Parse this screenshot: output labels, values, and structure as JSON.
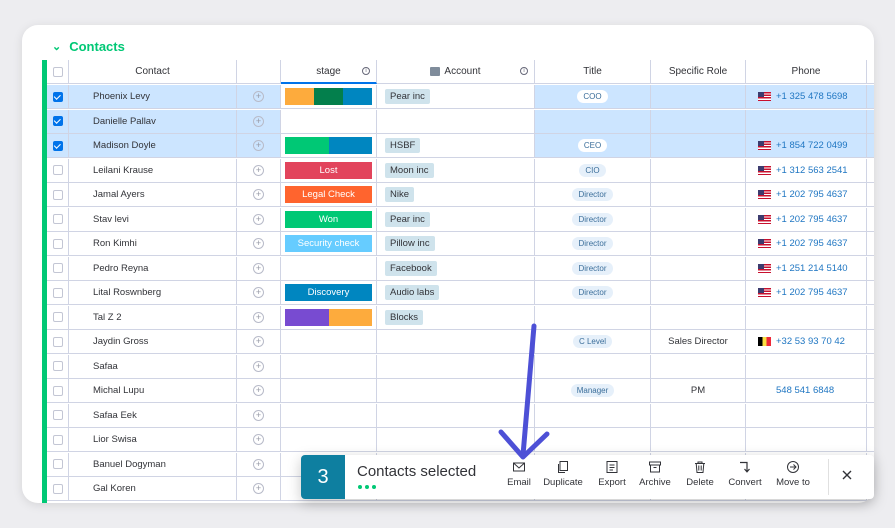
{
  "group": {
    "title": "Contacts"
  },
  "columns": {
    "contact": "Contact",
    "stage": "stage",
    "account": "Account",
    "title": "Title",
    "role": "Specific Role",
    "phone": "Phone"
  },
  "rows": [
    {
      "checked": true,
      "name": "Phoenix Levy",
      "stage": {
        "segments": [
          "#fdab3d",
          "#037f4c",
          "#0086c0"
        ]
      },
      "account": "Pear inc",
      "title": "COO",
      "role": "",
      "phone": {
        "flag": "us",
        "number": "+1 325 478 5698"
      }
    },
    {
      "checked": true,
      "name": "Danielle Pallav",
      "stage": null,
      "account": "",
      "title": "",
      "role": "",
      "phone": null
    },
    {
      "checked": true,
      "name": "Madison Doyle",
      "stage": {
        "segments": [
          "#00c875",
          "#0086c0"
        ]
      },
      "account": "HSBF",
      "title": "CEO",
      "role": "",
      "phone": {
        "flag": "us",
        "number": "+1 854 722 0499"
      }
    },
    {
      "checked": false,
      "name": "Leilani Krause",
      "stage": {
        "label": "Lost",
        "color": "#e2445c"
      },
      "account": "Moon inc",
      "title": "CIO",
      "role": "",
      "phone": {
        "flag": "us",
        "number": "+1 312 563 2541"
      }
    },
    {
      "checked": false,
      "name": "Jamal Ayers",
      "stage": {
        "label": "Legal Check",
        "color": "#ff642e"
      },
      "account": "Nike",
      "title": "Director",
      "role": "",
      "phone": {
        "flag": "us",
        "number": "+1 202 795 4637"
      }
    },
    {
      "checked": false,
      "name": "Stav levi",
      "stage": {
        "label": "Won",
        "color": "#00c875"
      },
      "account": "Pear inc",
      "title": "Director",
      "role": "",
      "phone": {
        "flag": "us",
        "number": "+1 202 795 4637"
      }
    },
    {
      "checked": false,
      "name": "Ron Kimhi",
      "stage": {
        "label": "Security check",
        "color": "#66ccff"
      },
      "account": "Pillow inc",
      "title": "Director",
      "role": "",
      "phone": {
        "flag": "us",
        "number": "+1 202 795 4637"
      }
    },
    {
      "checked": false,
      "name": "Pedro Reyna",
      "stage": null,
      "account": "Facebook",
      "title": "Director",
      "role": "",
      "phone": {
        "flag": "us",
        "number": "+1 251 214 5140"
      }
    },
    {
      "checked": false,
      "name": "Lital Roswnberg",
      "stage": {
        "label": "Discovery",
        "color": "#0086c0"
      },
      "account": "Audio labs",
      "title": "Director",
      "role": "",
      "phone": {
        "flag": "us",
        "number": "+1 202 795 4637"
      }
    },
    {
      "checked": false,
      "name": "Tal Z 2",
      "stage": {
        "segments": [
          "#784bd1",
          "#fdab3d"
        ]
      },
      "account": "Blocks",
      "title": "",
      "role": "",
      "phone": null
    },
    {
      "checked": false,
      "name": "Jaydin Gross",
      "stage": null,
      "account": "",
      "title": "C Level",
      "role": "Sales Director",
      "phone": {
        "flag": "be",
        "number": "+32 53 93 70 42"
      }
    },
    {
      "checked": false,
      "name": "Safaa",
      "stage": null,
      "account": "",
      "title": "",
      "role": "",
      "phone": null
    },
    {
      "checked": false,
      "name": "Michal Lupu",
      "stage": null,
      "account": "",
      "title": "Manager",
      "role": "PM",
      "phone": {
        "flag": "",
        "number": "548 541 6848"
      }
    },
    {
      "checked": false,
      "name": "Safaa Eek",
      "stage": null,
      "account": "",
      "title": "",
      "role": "",
      "phone": null
    },
    {
      "checked": false,
      "name": "Lior Swisa",
      "stage": null,
      "account": "",
      "title": "",
      "role": "",
      "phone": null
    },
    {
      "checked": false,
      "name": "Banuel Dogyman",
      "stage": null,
      "account": "",
      "title": "",
      "role": "",
      "phone": null
    },
    {
      "checked": false,
      "name": "Gal Koren",
      "stage": null,
      "account": "",
      "title": "",
      "role": "",
      "phone": null
    }
  ],
  "action_bar": {
    "count": "3",
    "label": "Contacts selected",
    "actions": [
      {
        "name": "email",
        "label": "Email",
        "icon": "envelope-icon"
      },
      {
        "name": "duplicate",
        "label": "Duplicate",
        "icon": "duplicate-icon"
      },
      {
        "name": "export",
        "label": "Export",
        "icon": "export-icon"
      },
      {
        "name": "archive",
        "label": "Archive",
        "icon": "archive-icon"
      },
      {
        "name": "delete",
        "label": "Delete",
        "icon": "trash-icon"
      },
      {
        "name": "convert",
        "label": "Convert",
        "icon": "convert-icon"
      },
      {
        "name": "move-to",
        "label": "Move to",
        "icon": "move-to-icon"
      }
    ]
  },
  "colors": {
    "accent": "#00c875",
    "primary": "#0073ea",
    "count_box": "#0e7fa0",
    "arrow": "#4d50d6"
  }
}
